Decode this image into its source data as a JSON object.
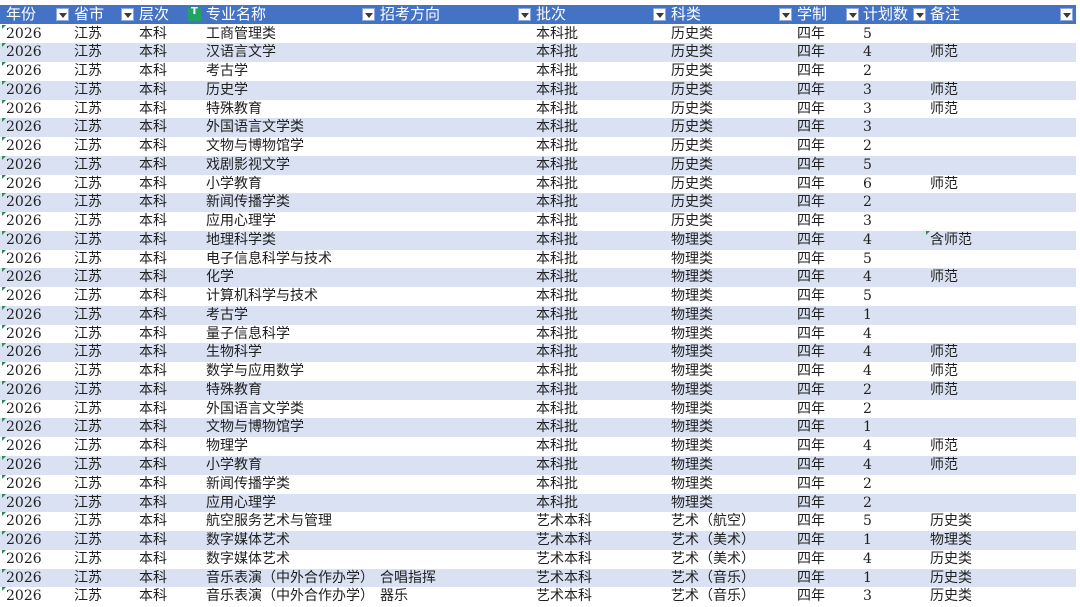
{
  "table": {
    "columns": [
      {
        "label": "年份",
        "filter": "dropdown"
      },
      {
        "label": "省市",
        "filter": "dropdown"
      },
      {
        "label": "层次",
        "filter": "active"
      },
      {
        "label": "专业名称",
        "filter": "dropdown"
      },
      {
        "label": "招考方向",
        "filter": "dropdown"
      },
      {
        "label": "批次",
        "filter": "dropdown"
      },
      {
        "label": "科类",
        "filter": "dropdown"
      },
      {
        "label": "学制",
        "filter": "dropdown"
      },
      {
        "label": "计划数",
        "filter": "dropdown"
      },
      {
        "label": "备注",
        "filter": "dropdown"
      }
    ],
    "rows": [
      [
        "2026",
        "江苏",
        "本科",
        "工商管理类",
        "",
        "本科批",
        "历史类",
        "四年",
        "5",
        ""
      ],
      [
        "2026",
        "江苏",
        "本科",
        "汉语言文学",
        "",
        "本科批",
        "历史类",
        "四年",
        "4",
        "师范"
      ],
      [
        "2026",
        "江苏",
        "本科",
        "考古学",
        "",
        "本科批",
        "历史类",
        "四年",
        "2",
        ""
      ],
      [
        "2026",
        "江苏",
        "本科",
        "历史学",
        "",
        "本科批",
        "历史类",
        "四年",
        "3",
        "师范"
      ],
      [
        "2026",
        "江苏",
        "本科",
        "特殊教育",
        "",
        "本科批",
        "历史类",
        "四年",
        "3",
        "师范"
      ],
      [
        "2026",
        "江苏",
        "本科",
        "外国语言文学类",
        "",
        "本科批",
        "历史类",
        "四年",
        "3",
        ""
      ],
      [
        "2026",
        "江苏",
        "本科",
        "文物与博物馆学",
        "",
        "本科批",
        "历史类",
        "四年",
        "2",
        ""
      ],
      [
        "2026",
        "江苏",
        "本科",
        "戏剧影视文学",
        "",
        "本科批",
        "历史类",
        "四年",
        "5",
        ""
      ],
      [
        "2026",
        "江苏",
        "本科",
        "小学教育",
        "",
        "本科批",
        "历史类",
        "四年",
        "6",
        "师范"
      ],
      [
        "2026",
        "江苏",
        "本科",
        "新闻传播学类",
        "",
        "本科批",
        "历史类",
        "四年",
        "2",
        ""
      ],
      [
        "2026",
        "江苏",
        "本科",
        "应用心理学",
        "",
        "本科批",
        "历史类",
        "四年",
        "3",
        ""
      ],
      [
        "2026",
        "江苏",
        "本科",
        "地理科学类",
        "",
        "本科批",
        "物理类",
        "四年",
        "4",
        "含师范"
      ],
      [
        "2026",
        "江苏",
        "本科",
        "电子信息科学与技术",
        "",
        "本科批",
        "物理类",
        "四年",
        "5",
        ""
      ],
      [
        "2026",
        "江苏",
        "本科",
        "化学",
        "",
        "本科批",
        "物理类",
        "四年",
        "4",
        "师范"
      ],
      [
        "2026",
        "江苏",
        "本科",
        "计算机科学与技术",
        "",
        "本科批",
        "物理类",
        "四年",
        "5",
        ""
      ],
      [
        "2026",
        "江苏",
        "本科",
        "考古学",
        "",
        "本科批",
        "物理类",
        "四年",
        "1",
        ""
      ],
      [
        "2026",
        "江苏",
        "本科",
        "量子信息科学",
        "",
        "本科批",
        "物理类",
        "四年",
        "4",
        ""
      ],
      [
        "2026",
        "江苏",
        "本科",
        "生物科学",
        "",
        "本科批",
        "物理类",
        "四年",
        "4",
        "师范"
      ],
      [
        "2026",
        "江苏",
        "本科",
        "数学与应用数学",
        "",
        "本科批",
        "物理类",
        "四年",
        "4",
        "师范"
      ],
      [
        "2026",
        "江苏",
        "本科",
        "特殊教育",
        "",
        "本科批",
        "物理类",
        "四年",
        "2",
        "师范"
      ],
      [
        "2026",
        "江苏",
        "本科",
        "外国语言文学类",
        "",
        "本科批",
        "物理类",
        "四年",
        "2",
        ""
      ],
      [
        "2026",
        "江苏",
        "本科",
        "文物与博物馆学",
        "",
        "本科批",
        "物理类",
        "四年",
        "1",
        ""
      ],
      [
        "2026",
        "江苏",
        "本科",
        "物理学",
        "",
        "本科批",
        "物理类",
        "四年",
        "4",
        "师范"
      ],
      [
        "2026",
        "江苏",
        "本科",
        "小学教育",
        "",
        "本科批",
        "物理类",
        "四年",
        "4",
        "师范"
      ],
      [
        "2026",
        "江苏",
        "本科",
        "新闻传播学类",
        "",
        "本科批",
        "物理类",
        "四年",
        "2",
        ""
      ],
      [
        "2026",
        "江苏",
        "本科",
        "应用心理学",
        "",
        "本科批",
        "物理类",
        "四年",
        "2",
        ""
      ],
      [
        "2026",
        "江苏",
        "本科",
        "航空服务艺术与管理",
        "",
        "艺术本科",
        "艺术（航空）",
        "四年",
        "5",
        "历史类"
      ],
      [
        "2026",
        "江苏",
        "本科",
        "数字媒体艺术",
        "",
        "艺术本科",
        "艺术（美术）",
        "四年",
        "1",
        "物理类"
      ],
      [
        "2026",
        "江苏",
        "本科",
        "数字媒体艺术",
        "",
        "艺术本科",
        "艺术（美术）",
        "四年",
        "4",
        "历史类"
      ],
      [
        "2026",
        "江苏",
        "本科",
        "音乐表演（中外合作办学）",
        "合唱指挥",
        "艺术本科",
        "艺术（音乐）",
        "四年",
        "1",
        "历史类"
      ],
      [
        "2026",
        "江苏",
        "本科",
        "音乐表演（中外合作办学）",
        "器乐",
        "艺术本科",
        "艺术（音乐）",
        "四年",
        "3",
        "历史类"
      ]
    ]
  }
}
